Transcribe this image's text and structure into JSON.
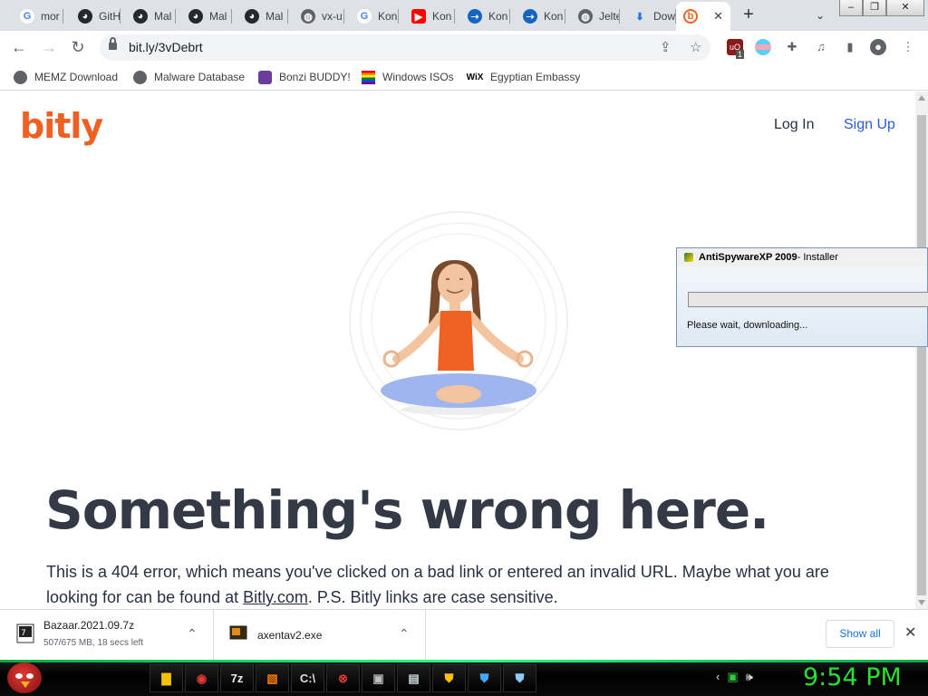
{
  "tabs": [
    {
      "icon": "google-icon",
      "label": "mor"
    },
    {
      "icon": "github-icon",
      "label": "GitH"
    },
    {
      "icon": "github-icon",
      "label": "Mal"
    },
    {
      "icon": "github-icon",
      "label": "Mal"
    },
    {
      "icon": "github-icon",
      "label": "Mal"
    },
    {
      "icon": "globe-icon",
      "label": "vx-u"
    },
    {
      "icon": "google-icon",
      "label": "Kon"
    },
    {
      "icon": "youtube-icon",
      "label": "Kon"
    },
    {
      "icon": "kon-icon",
      "label": "Kon"
    },
    {
      "icon": "kon-icon",
      "label": "Kon"
    },
    {
      "icon": "globe-icon",
      "label": "Jelte"
    },
    {
      "icon": "download-icon",
      "label": "Dow"
    },
    {
      "icon": "bitly-icon",
      "label": "",
      "active": true
    }
  ],
  "toolbar": {
    "url": "bit.ly/3vDebrt",
    "extension_badge": "1"
  },
  "bookmarks": [
    {
      "icon": "globe-icon",
      "label": "MEMZ Download"
    },
    {
      "icon": "globe-icon",
      "label": "Malware Database"
    },
    {
      "icon": "bonzi-icon",
      "label": "Bonzi BUDDY!"
    },
    {
      "icon": "rainbow-flag-icon",
      "label": "Windows ISOs"
    },
    {
      "icon": "wix-icon",
      "label": "Egyptian Embassy",
      "icon_text": "WiX"
    }
  ],
  "page": {
    "logo": "bitly",
    "nav": {
      "login": "Log In",
      "signup": "Sign Up"
    },
    "headline": "Something's wrong here.",
    "paragraph_prefix": "This is a 404 error, which means you've clicked on a bad link or entered an invalid URL. Maybe what you are looking for can be found at ",
    "paragraph_link": "Bitly.com",
    "paragraph_suffix": ". P.S. Bitly links are case sensitive.",
    "colors": {
      "brand": "#ee6123",
      "heading": "#333a45",
      "signup": "#2a5bd7"
    }
  },
  "popup": {
    "title_bold": "AntiSpywareXP 2009",
    "title_rest": " - Installer",
    "message": "Please wait, downloading..."
  },
  "downloads": [
    {
      "name": "Bazaar.2021.09.7z",
      "status": "507/675 MB, 18 secs left"
    },
    {
      "name": "axentav2.exe",
      "status": ""
    }
  ],
  "shelf": {
    "show_all": "Show all"
  },
  "taskbar": {
    "clock": "9:54 PM",
    "tray_icons": [
      "back-icon",
      "battery-icon",
      "volume-icon"
    ],
    "pinned": [
      {
        "name": "explorer-icon",
        "glyph": "▇",
        "color": "#f2c200"
      },
      {
        "name": "chrome-icon",
        "glyph": "◉",
        "color": "#e53935"
      },
      {
        "name": "7zip-icon",
        "glyph": "7z",
        "color": "#eeeeee"
      },
      {
        "name": "app-icon",
        "glyph": "▧",
        "color": "#ff7a00"
      },
      {
        "name": "cmd-icon",
        "glyph": "C:\\",
        "color": "#dddddd"
      },
      {
        "name": "stop-icon",
        "glyph": "⊗",
        "color": "#e53935"
      },
      {
        "name": "window-icon",
        "glyph": "▣",
        "color": "#bdbdbd"
      },
      {
        "name": "form-icon",
        "glyph": "▤",
        "color": "#cfd8dc"
      },
      {
        "name": "shield-icon",
        "glyph": "⛊",
        "color": "#ffc107"
      },
      {
        "name": "shield-icon",
        "glyph": "⛊",
        "color": "#42a5f5"
      },
      {
        "name": "shield-icon",
        "glyph": "⛊",
        "color": "#90caf9"
      }
    ]
  }
}
